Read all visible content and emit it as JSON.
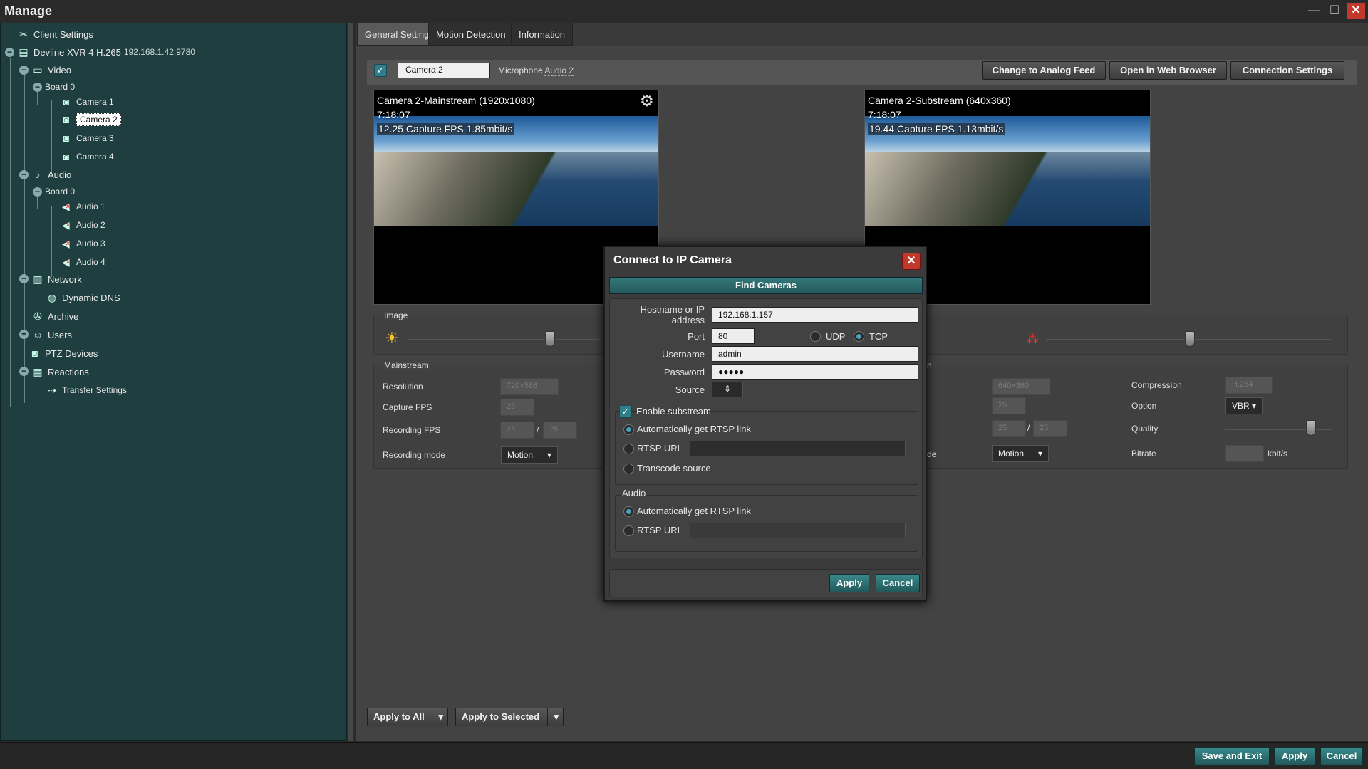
{
  "window": {
    "title": "Manage"
  },
  "tree": {
    "client_settings": "Client Settings",
    "server": "Devline XVR 4 H.265",
    "server_ip": "192.168.1.42:9780",
    "video": "Video",
    "video_board": "Board 0",
    "cameras": [
      "Camera 1",
      "Camera 2",
      "Camera 3",
      "Camera 4"
    ],
    "audio": "Audio",
    "audio_board": "Board 0",
    "audios": [
      "Audio 1",
      "Audio 2",
      "Audio 3",
      "Audio 4"
    ],
    "network": "Network",
    "dynamic_dns": "Dynamic DNS",
    "archive": "Archive",
    "users": "Users",
    "ptz": "PTZ Devices",
    "reactions": "Reactions",
    "transfer": "Transfer Settings"
  },
  "tabs": [
    "General Settings",
    "Motion Detection",
    "Information"
  ],
  "toolbar": {
    "camera_name": "Camera 2",
    "microphone_label": "Microphone",
    "microphone_value": "Audio 2",
    "analog_btn": "Change to Analog Feed",
    "browser_btn": "Open in Web Browser",
    "connection_btn": "Connection Settings"
  },
  "main_stream": {
    "title": "Camera 2-Mainstream (1920x1080)",
    "time": "7:18:07",
    "stats": "12.25 Capture FPS 1.85mbit/s"
  },
  "sub_stream": {
    "title": "Camera 2-Substream (640x360)",
    "time": "7:18:07",
    "stats": "19.44 Capture FPS 1.13mbit/s"
  },
  "image_group": {
    "title": "Image"
  },
  "mainstream_group": {
    "title": "Mainstream",
    "resolution_label": "Resolution",
    "resolution_value": "720×586",
    "capture_fps_label": "Capture FPS",
    "capture_fps_value": "25",
    "recording_fps_label": "Recording FPS",
    "rec_fps_a": "25",
    "rec_fps_b": "25",
    "slash": "/",
    "recording_mode_label": "Recording mode",
    "recording_mode_value": "Motion"
  },
  "substream_group": {
    "title_fragment": "n",
    "resolution_value": "640×360",
    "capture_fps_value": "25",
    "rec_fps_a": "25",
    "rec_fps_b": "25",
    "slash": "/",
    "mode_fragment": "de",
    "recording_mode_value": "Motion",
    "compression_label": "Compression",
    "compression_value": "H.264",
    "option_label": "Option",
    "option_value": "VBR",
    "quality_label": "Quality",
    "bitrate_label": "Bitrate",
    "bitrate_unit": "kbit/s"
  },
  "dialog": {
    "title": "Connect to IP Camera",
    "close": "✕",
    "find_cameras": "Find Cameras",
    "host_label": "Hostname or IP address",
    "host_value": "192.168.1.157",
    "port_label": "Port",
    "port_value": "80",
    "udp_label": "UDP",
    "tcp_label": "TCP",
    "username_label": "Username",
    "username_value": "admin",
    "password_label": "Password",
    "password_value": "●●●●●",
    "source_label": "Source",
    "enable_substream": "Enable substream",
    "auto_rtsp": "Automatically get RTSP link",
    "rtsp_url": "RTSP URL",
    "transcode": "Transcode source",
    "audio_title": "Audio",
    "audio_auto_rtsp": "Automatically get RTSP link",
    "audio_rtsp_url": "RTSP URL",
    "apply": "Apply",
    "cancel": "Cancel"
  },
  "bottom": {
    "apply_all": "Apply to All",
    "apply_selected": "Apply to Selected",
    "save_exit": "Save and Exit",
    "apply": "Apply",
    "cancel": "Cancel"
  },
  "colors": {
    "tree_bg": "#1f3e3f",
    "accent": "#2f7f8a",
    "close_red": "#c0392b"
  }
}
